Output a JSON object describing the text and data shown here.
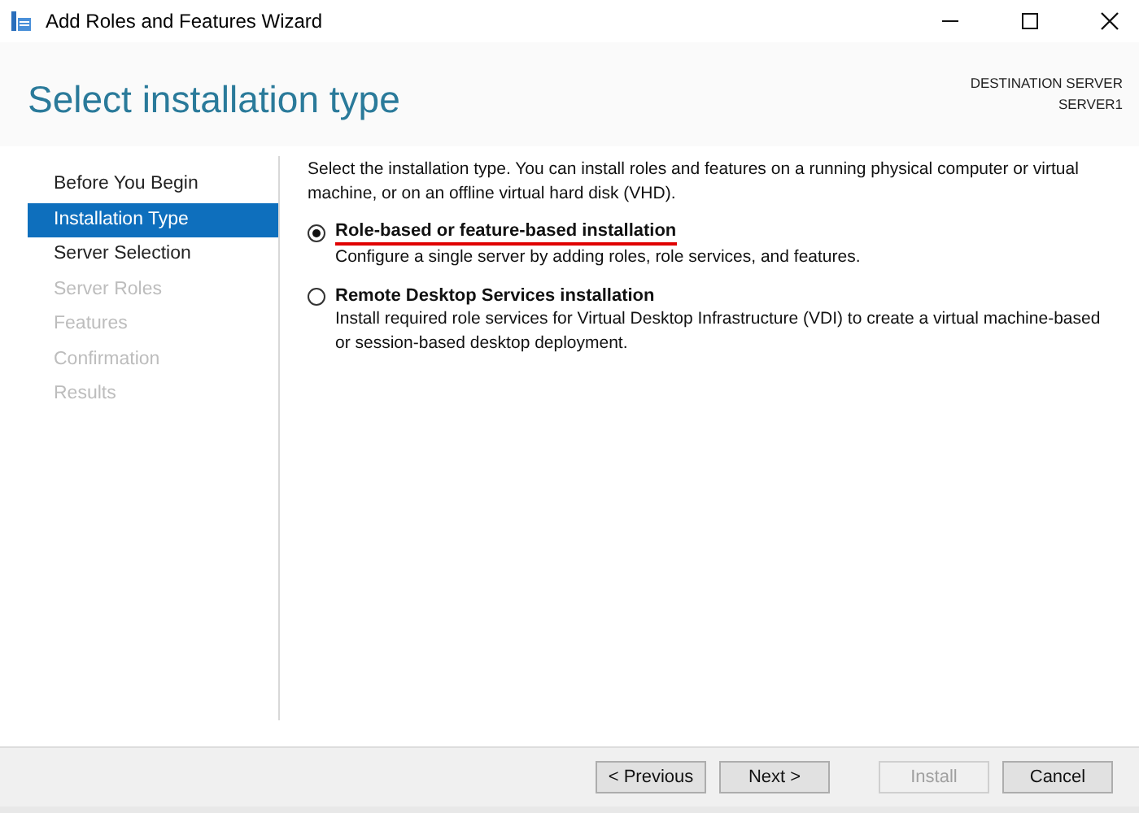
{
  "window": {
    "title": "Add Roles and Features Wizard"
  },
  "header": {
    "title": "Select installation type",
    "server_label": "DESTINATION SERVER",
    "server_name": "SERVER1"
  },
  "steps": [
    {
      "label": "Before You Begin",
      "selected": false,
      "disabled": false
    },
    {
      "label": "Installation Type",
      "selected": true,
      "disabled": false
    },
    {
      "label": "Server Selection",
      "selected": false,
      "disabled": false
    },
    {
      "label": "Server Roles",
      "selected": false,
      "disabled": true
    },
    {
      "label": "Features",
      "selected": false,
      "disabled": true
    },
    {
      "label": "Confirmation",
      "selected": false,
      "disabled": true
    },
    {
      "label": "Results",
      "selected": false,
      "disabled": true
    }
  ],
  "intro": "Select the installation type. You can install roles and features on a running physical computer or virtual machine, or on an offline virtual hard disk (VHD).",
  "options": [
    {
      "label": "Role-based or feature-based installation",
      "description": "Configure a single server by adding roles, role services, and features.",
      "selected": true,
      "underlined": true
    },
    {
      "label": "Remote Desktop Services installation",
      "description": "Install required role services for Virtual Desktop Infrastructure (VDI) to create a virtual machine-based or session-based desktop deployment.",
      "selected": false,
      "underlined": false
    }
  ],
  "buttons": [
    {
      "label": "< Previous",
      "disabled": false
    },
    {
      "label": "Next >",
      "disabled": false
    },
    {
      "label": "Install",
      "disabled": true
    },
    {
      "label": "Cancel",
      "disabled": false
    }
  ]
}
